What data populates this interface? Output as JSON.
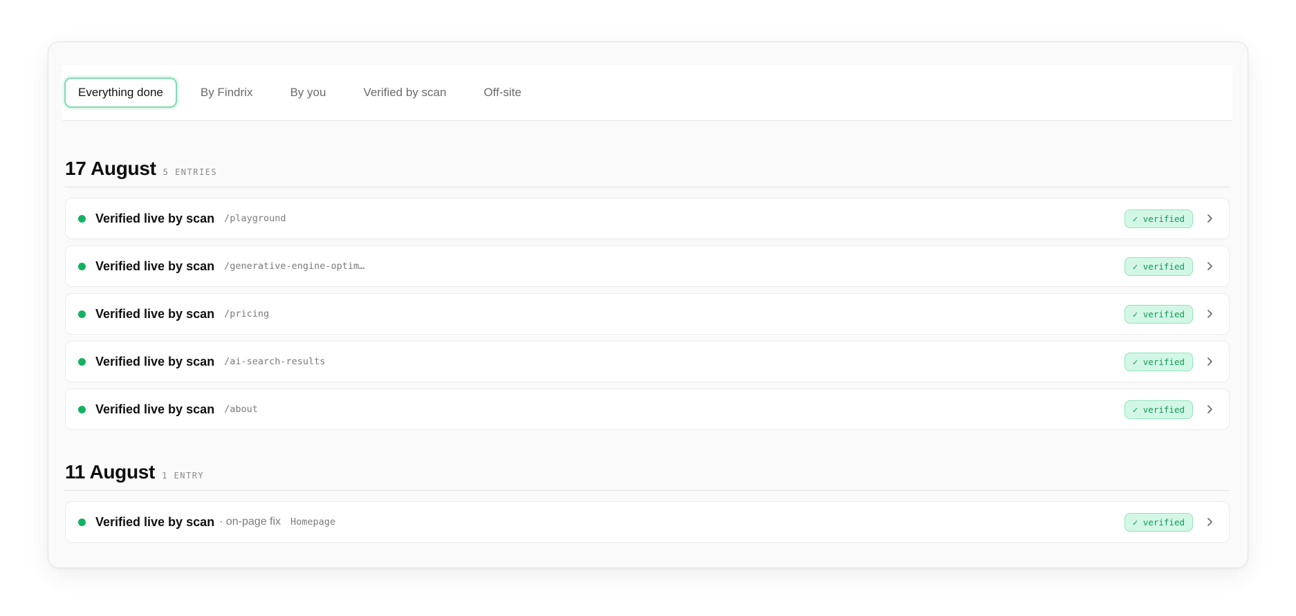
{
  "tabs": [
    "Everything done",
    "By Findrix",
    "By you",
    "Verified by scan",
    "Off-site"
  ],
  "active_tab": "Everything done",
  "groups": [
    {
      "title": "17 August",
      "count": "5 ENTRIES",
      "items": [
        {
          "title": "Verified live by scan",
          "sub": "",
          "path": "/playground",
          "badge": "✓ verified"
        },
        {
          "title": "Verified live by scan",
          "sub": "",
          "path": "/generative-engine-optim…",
          "badge": "✓ verified"
        },
        {
          "title": "Verified live by scan",
          "sub": "",
          "path": "/pricing",
          "badge": "✓ verified"
        },
        {
          "title": "Verified live by scan",
          "sub": "",
          "path": "/ai-search-results",
          "badge": "✓ verified"
        },
        {
          "title": "Verified live by scan",
          "sub": "",
          "path": "/about",
          "badge": "✓ verified"
        }
      ]
    },
    {
      "title": "11 August",
      "count": "1 ENTRY",
      "items": [
        {
          "title": "Verified live by scan",
          "sub": "· on-page fix",
          "path": "Homepage",
          "badge": "✓ verified"
        }
      ]
    }
  ],
  "icons": {
    "status": "status-dot-icon",
    "chevron": "chevron-right-icon"
  },
  "colors": {
    "accent": "#12b25f",
    "badge_bg": "#d3f7e6",
    "badge_border": "#8fe3bc",
    "badge_text": "#0f9a55",
    "active_tab_border": "#7ddcb0"
  }
}
